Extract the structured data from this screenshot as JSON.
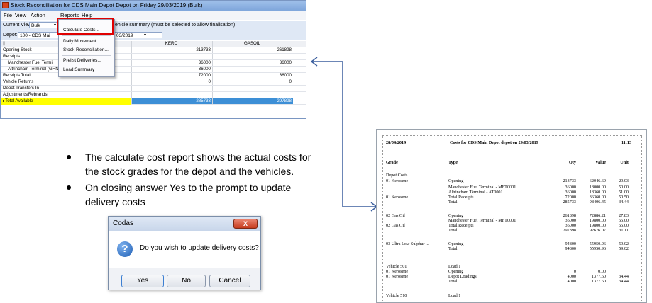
{
  "window": {
    "title": "Stock Reconciliation for CDS Main Depot Depot on Friday 29/03/2019 (Bulk)",
    "menus": [
      "File",
      "View",
      "Action",
      "Reports",
      "Help"
    ],
    "toolbar1": {
      "current_view_label": "Current View:",
      "current_view_value": "Bulk",
      "hint": "ehicle summary (must be selected to allow finalisation)"
    },
    "toolbar2": {
      "depot_label": "Depot:",
      "depot_value": "100 - CDS Mai",
      "date_value": "03/2019"
    },
    "grid": {
      "headers": [
        "",
        "KERO",
        "GASOIL"
      ],
      "rows": [
        {
          "label": "Opening Stock",
          "kero": "213733",
          "gasoil": "261898"
        },
        {
          "label": "Receipts",
          "kero": "",
          "gasoil": ""
        },
        {
          "label": "Manchester Fuel Termi",
          "kero": "36000",
          "gasoil": "36000"
        },
        {
          "label": "Altrincham Terminal (GHN: AT0001)",
          "kero": "36000",
          "gasoil": ""
        },
        {
          "label": "Receipts Total",
          "kero": "72000",
          "gasoil": "36000"
        },
        {
          "label": "Vehicle Returns",
          "kero": "0",
          "gasoil": "0"
        },
        {
          "label": "Depot Transfers In",
          "kero": "",
          "gasoil": ""
        },
        {
          "label": "Adjustments/Rebrands",
          "kero": "",
          "gasoil": ""
        },
        {
          "label": "Total Available",
          "kero": "285733",
          "gasoil": "297898"
        }
      ]
    },
    "reports_menu": [
      "Calculate Costs...",
      "Daily Movement...",
      "Stock Reconciliation...",
      "Prelist Deliveries...",
      "Load Summary"
    ]
  },
  "bullets": [
    "The calculate cost report shows the actual costs for the stock grades for the depot and the vehicles.",
    "On closing answer Yes to the prompt to update delivery costs"
  ],
  "dialog": {
    "title": "Codas",
    "close_glyph": "X",
    "message": "Do you wish to update delivery costs?",
    "buttons": [
      "Yes",
      "No",
      "Cancel"
    ]
  },
  "report": {
    "date": "28/04/2019",
    "title": "Costs for CDS Main Depot depot on 29/03/2019",
    "time": "11:13",
    "columns": [
      "Grade",
      "Type",
      "Qty",
      "Value",
      "Unit"
    ],
    "section": "Depot Costs",
    "lines": [
      [
        "01 Kerosene",
        "Opening",
        "213733",
        "62046.69",
        "29.03"
      ],
      [
        "",
        "Manchester Fuel Terminal - MFT0001",
        "36000",
        "18000.00",
        "50.00"
      ],
      [
        "",
        "Altrincham Terminal - AT0001",
        "36000",
        "18360.00",
        "51.00"
      ],
      [
        "01 Kerosene",
        "Total Receipts",
        "72000",
        "36360.00",
        "50.50"
      ],
      [
        "",
        "Total",
        "285733",
        "98406.45",
        "34.44"
      ],
      [
        "02 Gas Oil",
        "Opening",
        "261898",
        "72886.21",
        "27.83"
      ],
      [
        "",
        "Manchester Fuel Terminal - MFT0001",
        "36000",
        "19800.00",
        "55.00"
      ],
      [
        "02 Gas Oil",
        "Total Receipts",
        "36000",
        "19800.00",
        "55.00"
      ],
      [
        "",
        "Total",
        "297898",
        "92676.07",
        "31.11"
      ],
      [
        "03 Ultra Low Sulphur ...",
        "Opening",
        "94800",
        "55950.96",
        "59.02"
      ],
      [
        "",
        "Total",
        "94800",
        "55950.96",
        "59.02"
      ],
      [
        "Vehicle 501",
        "Load 1",
        "",
        "",
        ""
      ],
      [
        "01 Kerosene",
        "Opening",
        "0",
        "0.00",
        ""
      ],
      [
        "01 Kerosene",
        "Depot Loadings",
        "4000",
        "1377.60",
        "34.44"
      ],
      [
        "",
        "Total",
        "4000",
        "1377.60",
        "34.44"
      ],
      [
        "Vehicle 510",
        "Load 1",
        "",
        "",
        ""
      ]
    ]
  }
}
